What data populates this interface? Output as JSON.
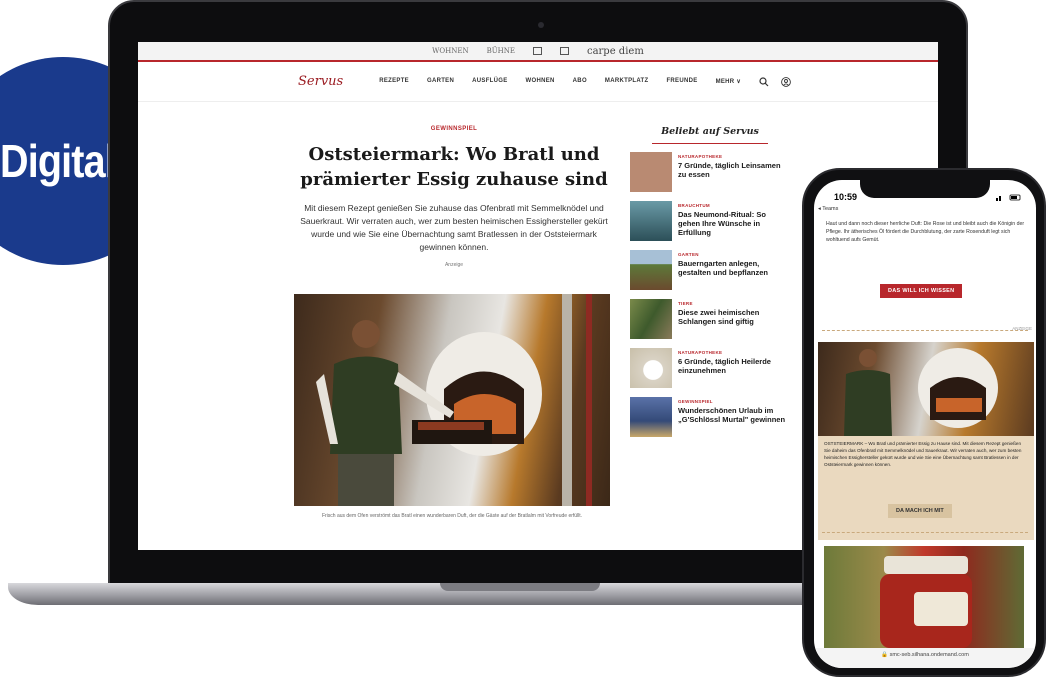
{
  "badge": {
    "label": "Digital"
  },
  "laptop": {
    "brand_bar": [
      "WOHNEN",
      "BÜHNE",
      "",
      "",
      "carpe diem",
      ""
    ],
    "logo": "Servus",
    "nav": [
      "REZEPTE",
      "GARTEN",
      "AUSFLÜGE",
      "WOHNEN",
      "ABO",
      "MARKTPLATZ",
      "FREUNDE",
      "MEHR ∨"
    ],
    "article": {
      "kicker": "GEWINNSPIEL",
      "headline": "Oststeiermark: Wo Bratl und prämierter Essig zuhause sind",
      "lead": "Mit diesem Rezept genießen Sie zuhause das Ofenbratl mit Semmelknödel und Sauerkraut. Wir verraten auch, wer zum besten heimischen Essighersteller gekürt wurde und wie Sie eine Übernachtung samt Bratlessen in der Oststeiermark gewinnen können.",
      "ad_label": "Anzeige",
      "caption": "Frisch aus dem Ofen verströmt das Bratl einen wunderbaren Duft, der die Gäste auf der Bratlalm mit Vorfreude erfüllt."
    },
    "sidebar": {
      "title": "Beliebt auf Servus",
      "items": [
        {
          "category": "NATURAPOTHEKE",
          "title": "7 Gründe, täglich Leinsamen zu essen",
          "thumb": "#b98a72"
        },
        {
          "category": "BRAUCHTUM",
          "title": "Das Neumond-Ritual: So gehen Ihre Wünsche in Erfüllung",
          "thumb": "#3f6f7a"
        },
        {
          "category": "GARTEN",
          "title": "Bauerngarten anlegen, gestalten und bepflanzen",
          "thumb": "#5c7a3a"
        },
        {
          "category": "TIERE",
          "title": "Diese zwei heimischen Schlangen sind giftig",
          "thumb": "#4e6b3c"
        },
        {
          "category": "NATURAPOTHEKE",
          "title": "6 Gründe, täglich Heilerde einzunehmen",
          "thumb": "#d9d2c4"
        },
        {
          "category": "GEWINNSPIEL",
          "title": "Wunderschönen Urlaub im „G'Schlössl Murtal\" gewinnen",
          "thumb": "#344a78"
        }
      ]
    }
  },
  "phone": {
    "time": "10:59",
    "back": "◂ Teams",
    "body_text": "Haut und dann noch dieser herrliche Duft: Die Rose ist und bleibt auch die Königin der Pflege. Ihr ätherisches Öl fördert die Durchblutung, der zarte Rosenduft legt sich wohltuend aufs Gemüt.",
    "button1": "DAS WILL ICH WISSEN",
    "ad_label": "ANZEIGE",
    "teaser": "OSTSTEIERMARK – Wo Bratl und prämierter Essig zu Hause sind. Mit diesem Rezept genießen Sie daheim das Ofenbratl mit Semmelknödel und Sauerkraut. Wir verraten auch, wer zum besten heimischen Essighersteller gekürt wurde und wie Sie eine Übernachtung samt Bratlessen in der Oststeiermark gewinnen können.",
    "button2": "DA MACH ICH MIT",
    "url": "🔒 smc-seb.silhana.ondemand.com"
  },
  "colors": {
    "accent": "#b8272c",
    "badge": "#1a3a8c",
    "beige": "#ead9bf"
  }
}
